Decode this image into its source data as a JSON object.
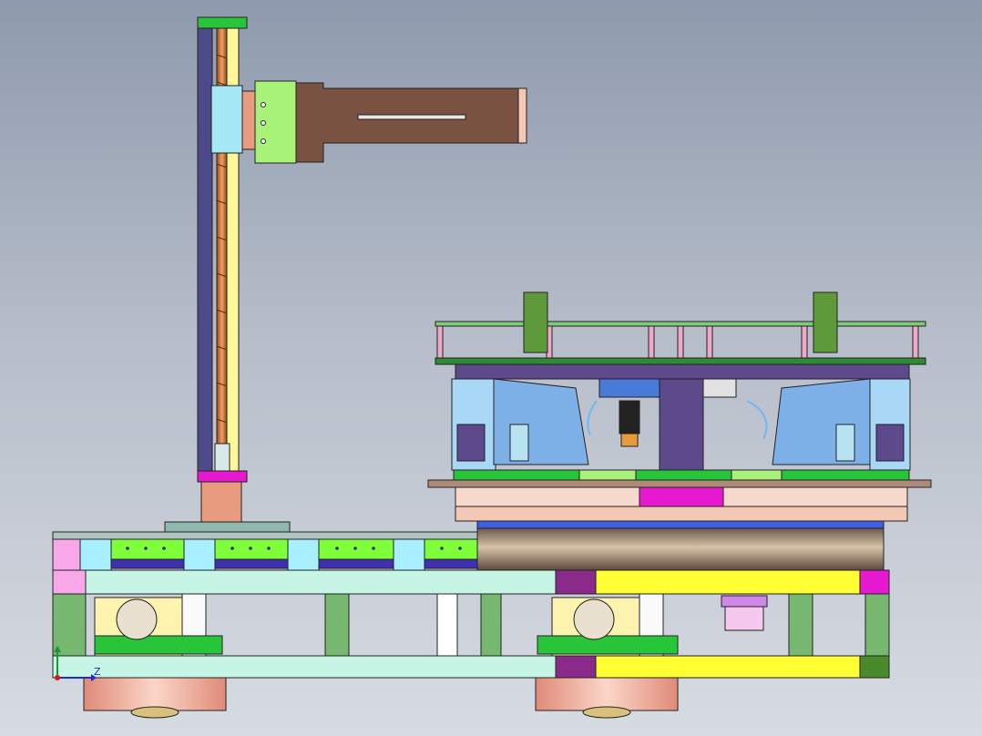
{
  "viewport": {
    "background_top": "#8e9aad",
    "background_bottom": "#d7dbe2"
  },
  "triad": {
    "axis_label": "Z",
    "z_axis_color": "#1b2cc8",
    "y_axis_color": "#1a9a2c",
    "x_axis_color": "#d21a1a"
  },
  "palette": {
    "chassis_plate": "#c6f5e6",
    "rail_yellow": "#ffff33",
    "conveyor_green": "#7dff3a",
    "lift_arm_brown": "#7a5242",
    "magenta_block": "#e619d0",
    "turntable_bronze": "#b59a7e",
    "drum_blue": "#3e5fe0",
    "motor_bell_pink": "#f7c4b4"
  }
}
